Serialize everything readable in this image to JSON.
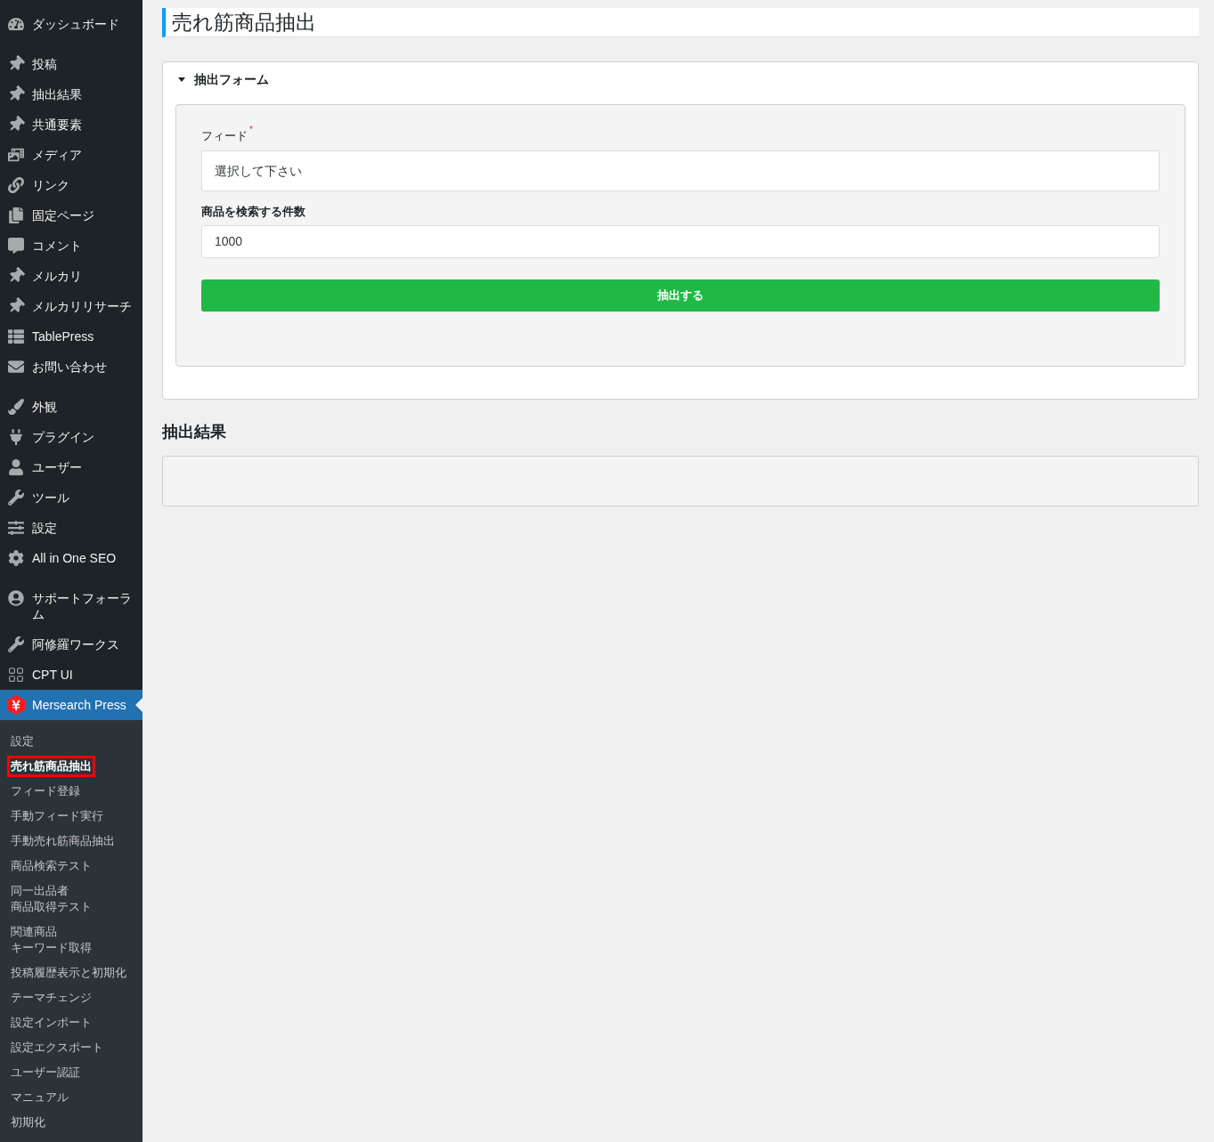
{
  "sidebar": {
    "groups": [
      {
        "items": [
          {
            "label": "ダッシュボード",
            "selected": false
          }
        ]
      },
      {
        "items": [
          {
            "label": "投稿",
            "selected": false
          },
          {
            "label": "抽出結果",
            "selected": false
          },
          {
            "label": "共通要素",
            "selected": false
          },
          {
            "label": "メディア",
            "selected": false
          },
          {
            "label": "リンク",
            "selected": false
          },
          {
            "label": "固定ページ",
            "selected": false
          },
          {
            "label": "コメント",
            "selected": false
          },
          {
            "label": "メルカリ",
            "selected": false
          },
          {
            "label": "メルカリリサーチ",
            "selected": false
          },
          {
            "label": "TablePress",
            "selected": false
          },
          {
            "label": "お問い合わせ",
            "selected": false
          }
        ]
      },
      {
        "items": [
          {
            "label": "外観",
            "selected": false
          },
          {
            "label": "プラグイン",
            "selected": false
          },
          {
            "label": "ユーザー",
            "selected": false
          },
          {
            "label": "ツール",
            "selected": false
          },
          {
            "label": "設定",
            "selected": false
          },
          {
            "label": "All in One SEO",
            "selected": false
          }
        ]
      },
      {
        "items": [
          {
            "label": "サポートフォーラム",
            "selected": false
          },
          {
            "label": "阿修羅ワークス",
            "selected": false
          },
          {
            "label": "CPT UI",
            "selected": false
          },
          {
            "label": "Mersearch Press",
            "selected": true,
            "submenu": [
              {
                "label": "設定",
                "selected": false
              },
              {
                "label": "売れ筋商品抽出",
                "selected": true
              },
              {
                "label": "フィード登録",
                "selected": false
              },
              {
                "label": "手動フィード実行",
                "selected": false
              },
              {
                "label": "手動売れ筋商品抽出",
                "selected": false
              },
              {
                "label": "商品検索テスト",
                "selected": false
              },
              {
                "lines": [
                  "同一出品者",
                  "商品取得テスト"
                ],
                "selected": false
              },
              {
                "lines": [
                  "関連商品",
                  "キーワード取得"
                ],
                "selected": false
              },
              {
                "label": "投稿履歴表示と初期化",
                "selected": false
              },
              {
                "label": "テーマチェンジ",
                "selected": false
              },
              {
                "label": "設定インポート",
                "selected": false
              },
              {
                "label": "設定エクスポート",
                "selected": false
              },
              {
                "label": "ユーザー認証",
                "selected": false
              },
              {
                "label": "マニュアル",
                "selected": false
              },
              {
                "label": "初期化",
                "selected": false
              }
            ]
          }
        ]
      }
    ]
  },
  "page_title": "売れ筋商品抽出",
  "form_panel": {
    "title": "抽出フォーム",
    "expanded": true,
    "fields": [
      {
        "kind": "select",
        "label": "フィード",
        "required_mark": "*",
        "value": "選択して下さい"
      },
      {
        "kind": "number",
        "label": "商品を検索する件数",
        "value": "1000"
      }
    ],
    "submit_button": "抽出する"
  },
  "results": {
    "heading": "抽出結果"
  }
}
